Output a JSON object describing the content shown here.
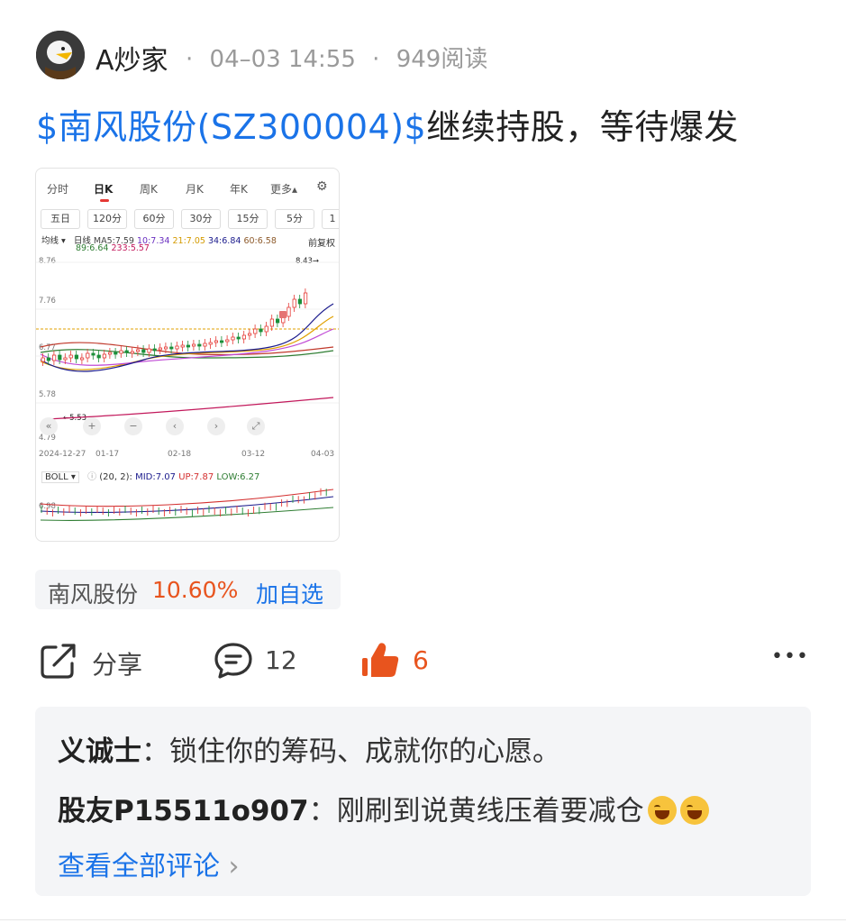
{
  "post": {
    "author": "A炒家",
    "separator": "·",
    "time": "04–03 14:55",
    "reads": "949阅读",
    "stock_tag": "$南风股份(SZ300004)$",
    "text": "继续持股，等待爆发"
  },
  "screenshot": {
    "tabs": [
      "分时",
      "日K",
      "周K",
      "月K",
      "年K",
      "更多▴"
    ],
    "periods": [
      "五日",
      "120分",
      "60分",
      "30分",
      "15分",
      "5分",
      "1"
    ],
    "avg_label": "均线 ▾",
    "legend_row1": {
      "prefix": "日线",
      "ma5": "MA5:7.59",
      "ma10": "10:7.34",
      "ma21": "21:7.05",
      "ma34": "34:6.84",
      "ma60": "60:6.58"
    },
    "legend_row2": {
      "ma89": "89:6.64",
      "ma233": "233:5.57"
    },
    "adj_label": "前复权",
    "y_labels": [
      "8.76",
      "7.76",
      "6.77",
      "5.78",
      "4.79"
    ],
    "high_label": "8.43→",
    "low_label": "←5.53",
    "x_labels": [
      "2024-12-27",
      "01-17",
      "02-18",
      "03-12",
      "04-03"
    ],
    "controls": [
      "«",
      "+",
      "−",
      "‹",
      "›",
      "⤢"
    ],
    "boll": {
      "name": "BOLL ▾",
      "params": "(20, 2):",
      "mid": "MID:7.07",
      "up": "UP:7.87",
      "low": "LOW:6.27",
      "y_label": "6.98"
    },
    "colors": {
      "ma5": "#1a1a8c",
      "ma10": "#e0a000",
      "ma21": "#c04bd6",
      "ma34": "#1f7a3a",
      "ma60": "#c0392b",
      "ma89": "#2e7d32",
      "ma233": "#c2185b",
      "up_candle": "#e53935",
      "down_candle": "#1b8f3a"
    }
  },
  "stock_chip": {
    "name": "南风股份",
    "change": "10.60%",
    "add": "加自选"
  },
  "actions": {
    "share": "分享",
    "comments": "12",
    "likes": "6",
    "more": "•••"
  },
  "comments": [
    {
      "user": "义诚士",
      "sep": "：",
      "text": "锁住你的筹码、成就你的心愿。"
    },
    {
      "user": "股友P15511o907",
      "sep": "：",
      "text": "刚刷到说黄线压着要减仓"
    }
  ],
  "view_all": "查看全部评论",
  "view_all_chevron": "›"
}
